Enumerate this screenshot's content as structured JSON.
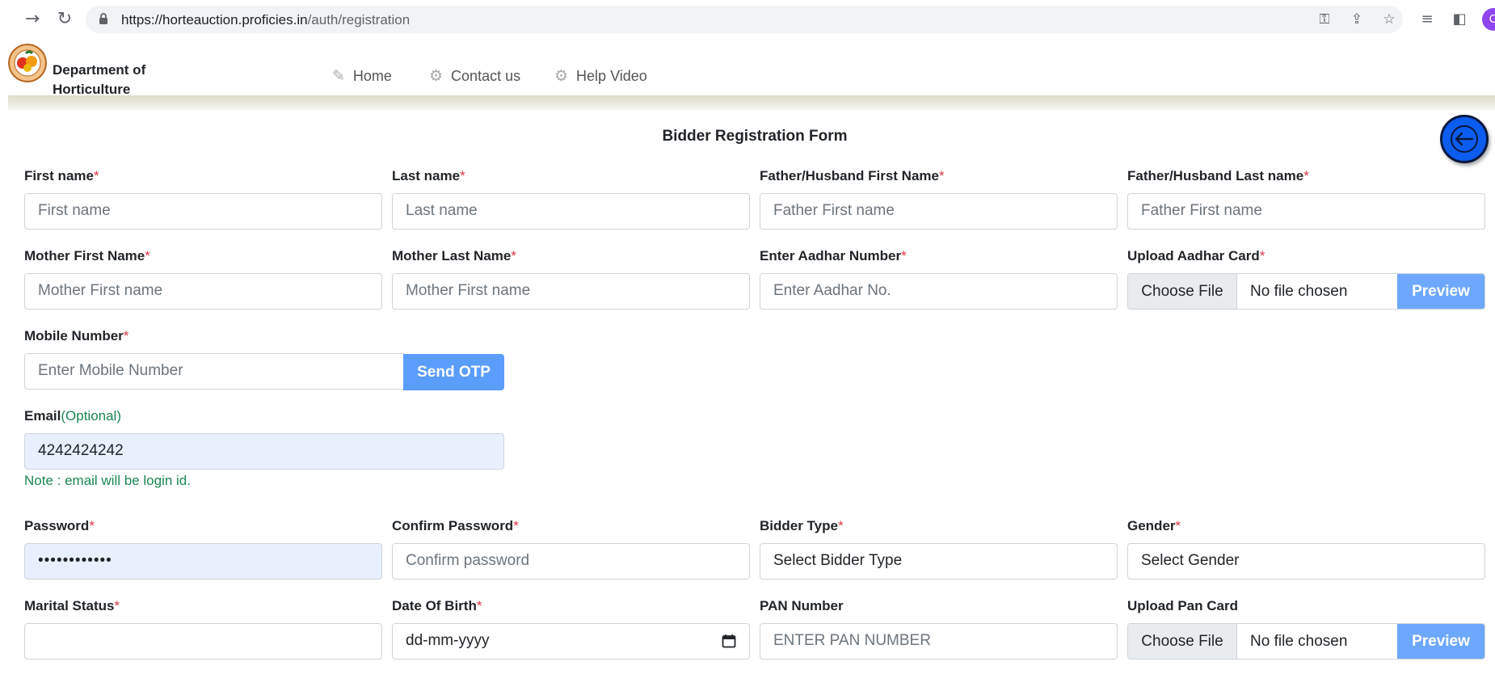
{
  "browser": {
    "url_host": "https://horteauction.proficies.in",
    "url_path": "/auth/registration",
    "profile_initial": "C"
  },
  "header": {
    "brand_line1": "Department of",
    "brand_line2": "Horticulture",
    "nav": [
      {
        "label": "Home",
        "icon": "edit-icon"
      },
      {
        "label": "Contact us",
        "icon": "gear-icon"
      },
      {
        "label": "Help Video",
        "icon": "gear-icon"
      }
    ]
  },
  "form": {
    "title": "Bidder Registration Form",
    "required_mark": "*",
    "first_name": {
      "label": "First name",
      "placeholder": "First name"
    },
    "last_name": {
      "label": "Last name",
      "placeholder": "Last name"
    },
    "father_first": {
      "label": "Father/Husband First Name",
      "placeholder": "Father First name"
    },
    "father_last": {
      "label": "Father/Husband Last name",
      "placeholder": "Father First name"
    },
    "mother_first": {
      "label": "Mother First Name",
      "placeholder": "Mother First name"
    },
    "mother_last": {
      "label": "Mother Last Name",
      "placeholder": "Mother First name"
    },
    "aadhar_number": {
      "label": "Enter Aadhar Number",
      "placeholder": "Enter Aadhar No."
    },
    "aadhar_upload": {
      "label": "Upload Aadhar Card",
      "choose": "Choose File",
      "file": "No file chosen",
      "preview": "Preview"
    },
    "mobile": {
      "label": "Mobile Number",
      "placeholder": "Enter Mobile Number",
      "otp_button": "Send OTP"
    },
    "email": {
      "label": "Email",
      "optional": "(Optional)",
      "value": "4242424242",
      "note": "Note : email will be login id."
    },
    "password": {
      "label": "Password",
      "value": "••••••••••••"
    },
    "confirm_password": {
      "label": "Confirm Password",
      "placeholder": "Confirm password"
    },
    "bidder_type": {
      "label": "Bidder Type",
      "selected": "Select Bidder Type"
    },
    "gender": {
      "label": "Gender",
      "selected": "Select Gender"
    },
    "marital_status": {
      "label": "Marital Status",
      "selected": ""
    },
    "dob": {
      "label": "Date Of Birth",
      "placeholder": "dd-mm-yyyy"
    },
    "pan_number": {
      "label": "PAN Number",
      "placeholder": "ENTER PAN NUMBER"
    },
    "pan_upload": {
      "label": "Upload Pan Card",
      "choose": "Choose File",
      "file": "No file chosen",
      "preview": "Preview"
    }
  },
  "colors": {
    "accent": "#6ea8fe",
    "required": "#dc3545",
    "success": "#198754",
    "back_button": "#0d5cf0"
  }
}
